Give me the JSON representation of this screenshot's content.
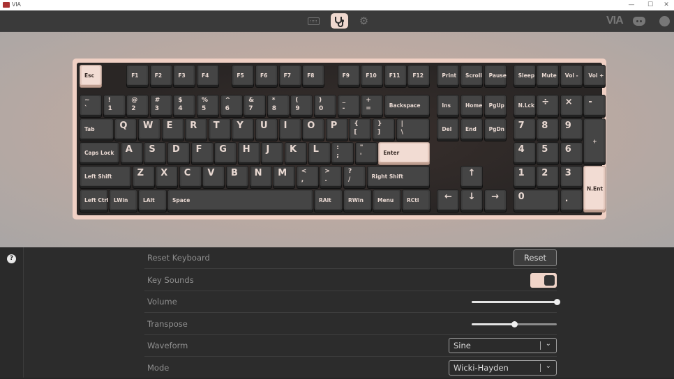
{
  "window": {
    "title": "VIA",
    "minimize": "—",
    "maximize": "☐",
    "close": "✕"
  },
  "toolbar": {
    "brand": "VIA"
  },
  "help": {
    "label": "?"
  },
  "rows": {
    "reset": {
      "label": "Reset Keyboard",
      "button": "Reset"
    },
    "sounds": {
      "label": "Key Sounds",
      "on": true
    },
    "volume": {
      "label": "Volume",
      "value": 1.0
    },
    "transpose": {
      "label": "Transpose",
      "value": 0.5
    },
    "waveform": {
      "label": "Waveform",
      "value": "Sine"
    },
    "mode": {
      "label": "Mode",
      "value": "Wicki-Hayden"
    }
  },
  "keys": [
    {
      "id": "esc",
      "t": "Esc",
      "s": "small",
      "accent": true
    },
    {
      "id": "f1",
      "t": "F1",
      "s": "small"
    },
    {
      "id": "f2",
      "t": "F2",
      "s": "small"
    },
    {
      "id": "f3",
      "t": "F3",
      "s": "small"
    },
    {
      "id": "f4",
      "t": "F4",
      "s": "small"
    },
    {
      "id": "f5",
      "t": "F5",
      "s": "small"
    },
    {
      "id": "f6",
      "t": "F6",
      "s": "small"
    },
    {
      "id": "f7",
      "t": "F7",
      "s": "small"
    },
    {
      "id": "f8",
      "t": "F8",
      "s": "small"
    },
    {
      "id": "f9",
      "t": "F9",
      "s": "small"
    },
    {
      "id": "f10",
      "t": "F10",
      "s": "small"
    },
    {
      "id": "f11",
      "t": "F11",
      "s": "small"
    },
    {
      "id": "f12",
      "t": "F12",
      "s": "small"
    },
    {
      "id": "print",
      "t": "Print",
      "s": "small"
    },
    {
      "id": "scroll",
      "t": "Scroll",
      "s": "small"
    },
    {
      "id": "pause",
      "t": "Pause",
      "s": "small"
    },
    {
      "id": "sleep",
      "t": "Sleep",
      "s": "small"
    },
    {
      "id": "mute",
      "t": "Mute",
      "s": "small"
    },
    {
      "id": "vol-down",
      "t": "Vol -",
      "s": "small"
    },
    {
      "id": "vol-up",
      "t": "Vol +",
      "s": "small"
    },
    {
      "id": "grave",
      "t": "~",
      "b": "`",
      "s": "dual"
    },
    {
      "id": "1",
      "t": "!",
      "b": "1",
      "s": "dual"
    },
    {
      "id": "2",
      "t": "@",
      "b": "2",
      "s": "dual"
    },
    {
      "id": "3",
      "t": "#",
      "b": "3",
      "s": "dual"
    },
    {
      "id": "4",
      "t": "$",
      "b": "4",
      "s": "dual"
    },
    {
      "id": "5",
      "t": "%",
      "b": "5",
      "s": "dual"
    },
    {
      "id": "6",
      "t": "^",
      "b": "6",
      "s": "dual"
    },
    {
      "id": "7",
      "t": "&",
      "b": "7",
      "s": "dual"
    },
    {
      "id": "8",
      "t": "*",
      "b": "8",
      "s": "dual"
    },
    {
      "id": "9",
      "t": "(",
      "b": "9",
      "s": "dual"
    },
    {
      "id": "0",
      "t": ")",
      "b": "0",
      "s": "dual"
    },
    {
      "id": "minus",
      "t": "_",
      "b": "-",
      "s": "dual"
    },
    {
      "id": "equal",
      "t": "+",
      "b": "=",
      "s": "dual"
    },
    {
      "id": "backspace",
      "t": "Backspace",
      "s": "small"
    },
    {
      "id": "ins",
      "t": "Ins",
      "s": "small"
    },
    {
      "id": "home",
      "t": "Home",
      "s": "small"
    },
    {
      "id": "pgup",
      "t": "PgUp",
      "s": "small"
    },
    {
      "id": "nlck",
      "t": "N.Lck",
      "s": "small"
    },
    {
      "id": "kp-div",
      "t": "÷",
      "s": "big"
    },
    {
      "id": "kp-mul",
      "t": "×",
      "s": "big"
    },
    {
      "id": "kp-sub",
      "t": "-",
      "s": "big"
    },
    {
      "id": "tab",
      "t": "Tab",
      "s": "small"
    },
    {
      "id": "q",
      "t": "Q",
      "s": "big"
    },
    {
      "id": "w",
      "t": "W",
      "s": "big"
    },
    {
      "id": "e",
      "t": "E",
      "s": "big"
    },
    {
      "id": "r",
      "t": "R",
      "s": "big"
    },
    {
      "id": "t",
      "t": "T",
      "s": "big"
    },
    {
      "id": "y",
      "t": "Y",
      "s": "big"
    },
    {
      "id": "u",
      "t": "U",
      "s": "big"
    },
    {
      "id": "i",
      "t": "I",
      "s": "big"
    },
    {
      "id": "o",
      "t": "O",
      "s": "big"
    },
    {
      "id": "p",
      "t": "P",
      "s": "big"
    },
    {
      "id": "lbracket",
      "t": "{",
      "b": "[",
      "s": "dual"
    },
    {
      "id": "rbracket",
      "t": "}",
      "b": "]",
      "s": "dual"
    },
    {
      "id": "backslash",
      "t": "|",
      "b": "\\",
      "s": "dual"
    },
    {
      "id": "del",
      "t": "Del",
      "s": "small"
    },
    {
      "id": "end",
      "t": "End",
      "s": "small"
    },
    {
      "id": "pgdn",
      "t": "PgDn",
      "s": "small"
    },
    {
      "id": "kp7",
      "t": "7",
      "s": "big"
    },
    {
      "id": "kp8",
      "t": "8",
      "s": "big"
    },
    {
      "id": "kp9",
      "t": "9",
      "s": "big"
    },
    {
      "id": "kp-add",
      "t": "+",
      "s": "mid"
    },
    {
      "id": "caps",
      "t": "Caps Lock",
      "s": "small"
    },
    {
      "id": "a",
      "t": "A",
      "s": "big"
    },
    {
      "id": "s",
      "t": "S",
      "s": "big"
    },
    {
      "id": "d",
      "t": "D",
      "s": "big"
    },
    {
      "id": "f",
      "t": "F",
      "s": "big"
    },
    {
      "id": "g",
      "t": "G",
      "s": "big"
    },
    {
      "id": "h",
      "t": "H",
      "s": "big"
    },
    {
      "id": "j",
      "t": "J",
      "s": "big"
    },
    {
      "id": "k",
      "t": "K",
      "s": "big"
    },
    {
      "id": "l",
      "t": "L",
      "s": "big"
    },
    {
      "id": "semicolon",
      "t": ":",
      "b": ";",
      "s": "dual"
    },
    {
      "id": "quote",
      "t": "\"",
      "b": "'",
      "s": "dual"
    },
    {
      "id": "enter",
      "t": "Enter",
      "s": "small",
      "accent": true
    },
    {
      "id": "kp4",
      "t": "4",
      "s": "big"
    },
    {
      "id": "kp5",
      "t": "5",
      "s": "big"
    },
    {
      "id": "kp6",
      "t": "6",
      "s": "big"
    },
    {
      "id": "lshift",
      "t": "Left Shift",
      "s": "small"
    },
    {
      "id": "z",
      "t": "Z",
      "s": "big"
    },
    {
      "id": "x",
      "t": "X",
      "s": "big"
    },
    {
      "id": "c",
      "t": "C",
      "s": "big"
    },
    {
      "id": "v",
      "t": "V",
      "s": "big"
    },
    {
      "id": "b",
      "t": "B",
      "s": "big"
    },
    {
      "id": "n",
      "t": "N",
      "s": "big"
    },
    {
      "id": "m",
      "t": "M",
      "s": "big"
    },
    {
      "id": "comma",
      "t": "<",
      "b": ",",
      "s": "dual"
    },
    {
      "id": "period",
      "t": ">",
      "b": ".",
      "s": "dual"
    },
    {
      "id": "slash",
      "t": "?",
      "b": "/",
      "s": "dual"
    },
    {
      "id": "rshift",
      "t": "Right Shift",
      "s": "small"
    },
    {
      "id": "up",
      "t": "↑",
      "s": "center"
    },
    {
      "id": "kp1",
      "t": "1",
      "s": "big"
    },
    {
      "id": "kp2",
      "t": "2",
      "s": "big"
    },
    {
      "id": "kp3",
      "t": "3",
      "s": "big"
    },
    {
      "id": "kp-enter",
      "t": "N.Ent",
      "s": "mid",
      "accent": true
    },
    {
      "id": "lctrl",
      "t": "Left Ctrl",
      "s": "small"
    },
    {
      "id": "lwin",
      "t": "LWin",
      "s": "small"
    },
    {
      "id": "lalt",
      "t": "LAlt",
      "s": "small"
    },
    {
      "id": "space",
      "t": "Space",
      "s": "small"
    },
    {
      "id": "ralt",
      "t": "RAlt",
      "s": "small"
    },
    {
      "id": "rwin",
      "t": "RWin",
      "s": "small"
    },
    {
      "id": "menu",
      "t": "Menu",
      "s": "small"
    },
    {
      "id": "rctrl",
      "t": "RCtl",
      "s": "small"
    },
    {
      "id": "left",
      "t": "←",
      "s": "center"
    },
    {
      "id": "down",
      "t": "↓",
      "s": "center"
    },
    {
      "id": "right",
      "t": "→",
      "s": "center"
    },
    {
      "id": "kp0",
      "t": "0",
      "s": "big"
    },
    {
      "id": "kp-dot",
      "t": ".",
      "s": "center-lo"
    }
  ]
}
